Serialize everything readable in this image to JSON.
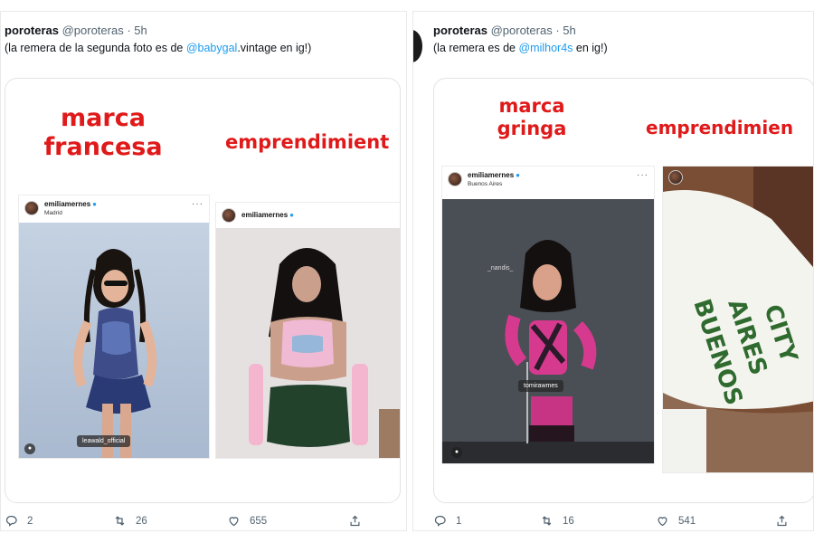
{
  "tweets": [
    {
      "author": "poroteras",
      "handle": "@poroteras",
      "time": "· 5h",
      "text_before": "(la remera de la segunda foto es de ",
      "mention": "@babygal",
      "text_after": ".vintage en ig!)",
      "captions": [
        "marca\nfrancesa",
        "emprendimient"
      ],
      "cards": [
        {
          "user": "emiliamernes",
          "location": "Madrid",
          "tag": "leawald_official"
        },
        {
          "user": "emiliamernes",
          "location": ""
        }
      ],
      "actions": {
        "replies": "2",
        "retweets": "26",
        "likes": "655"
      }
    },
    {
      "author": "poroteras",
      "handle": "@poroteras",
      "time": "· 5h",
      "text_before": "(la remera es de ",
      "mention": "@milhor4s",
      "text_after": " en ig!)",
      "captions": [
        "marca\ngringa",
        "emprendimien"
      ],
      "cards": [
        {
          "user": "emiliamernes",
          "location": "Buenos Aires",
          "tags": [
            "_nandis_",
            "tomirawmes"
          ]
        },
        {
          "user": "emiliamernes",
          "location": "",
          "shirt_text": [
            "BUENOS",
            "AIRES",
            "CITY"
          ]
        }
      ],
      "actions": {
        "replies": "1",
        "retweets": "16",
        "likes": "541"
      }
    }
  ],
  "colors": {
    "caption_red": "#e01a1a",
    "mention_blue": "#1d9bf0",
    "muted": "#536471",
    "shirt_green": "#2f6b2f"
  },
  "icons": [
    "reply-icon",
    "retweet-icon",
    "like-icon",
    "share-icon",
    "verified-icon",
    "more-icon",
    "person-tag-icon"
  ]
}
